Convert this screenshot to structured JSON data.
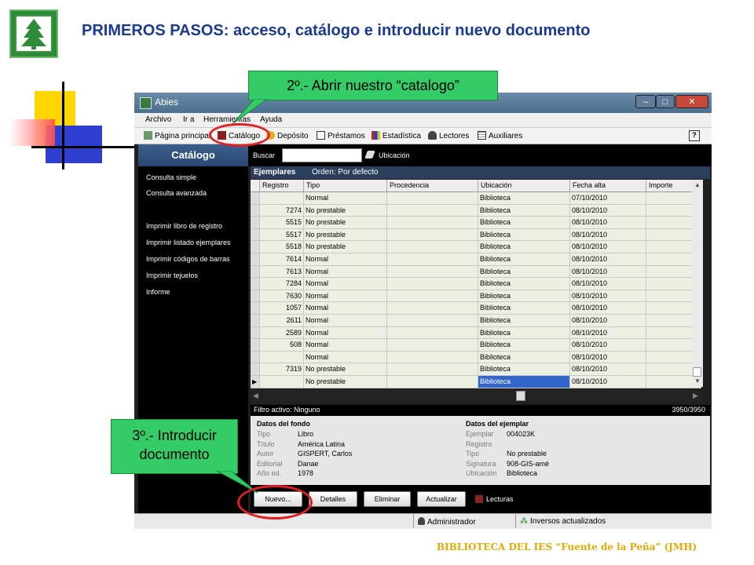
{
  "slide": {
    "title": "PRIMEROS PASOS: acceso, catálogo e introducir nuevo documento",
    "footer": "BIBLIOTECA DEL IES “Fuente de la Peña” (JMH)"
  },
  "callouts": {
    "step2": "2º.- Abrir nuestro “catalogo”",
    "step3_line1": "3º.- Introducir",
    "step3_line2": "documento"
  },
  "window": {
    "title": "Abies",
    "controls": {
      "minimize": "–",
      "maximize": "□",
      "close": "✕"
    },
    "menu": [
      "Archivo",
      "Ir a",
      "Herramientas",
      "Ayuda"
    ],
    "toolbar": [
      "Página principal",
      "Catálogo",
      "Depósito",
      "Préstamos",
      "Estadística",
      "Lectores",
      "Auxiliares"
    ],
    "help_button": "?"
  },
  "left_panel": {
    "title": "Catálogo",
    "items": [
      "Consulta simple",
      "Consulta avanzada",
      "Imprimir libro de registro",
      "Imprimir listado ejemplares",
      "Imprimir códigos de barras",
      "Imprimir tejuelos",
      "Informe"
    ]
  },
  "search": {
    "label": "Buscar",
    "value": "",
    "location_label": "Ubicación"
  },
  "ejemplares": {
    "title": "Ejemplares",
    "order": "Orden: Por defecto",
    "columns": [
      "Registro",
      "Tipo",
      "Procedencia",
      "Ubicación",
      "Fecha alta",
      "Importe"
    ],
    "rows": [
      [
        "",
        "Normal",
        "",
        "Biblioteca",
        "07/10/2010",
        ""
      ],
      [
        "7274",
        "No prestable",
        "",
        "Biblioteca",
        "08/10/2010",
        ""
      ],
      [
        "5515",
        "No prestable",
        "",
        "Biblioteca",
        "08/10/2010",
        ""
      ],
      [
        "5517",
        "No prestable",
        "",
        "Biblioteca",
        "08/10/2010",
        ""
      ],
      [
        "5518",
        "No prestable",
        "",
        "Biblioteca",
        "08/10/2010",
        ""
      ],
      [
        "7614",
        "Normal",
        "",
        "Biblioteca",
        "08/10/2010",
        ""
      ],
      [
        "7613",
        "Normal",
        "",
        "Biblioteca",
        "08/10/2010",
        ""
      ],
      [
        "7284",
        "Normal",
        "",
        "Biblioteca",
        "08/10/2010",
        ""
      ],
      [
        "7630",
        "Normal",
        "",
        "Biblioteca",
        "08/10/2010",
        ""
      ],
      [
        "1057",
        "Normal",
        "",
        "Biblioteca",
        "08/10/2010",
        ""
      ],
      [
        "2611",
        "Normal",
        "",
        "Biblioteca",
        "08/10/2010",
        ""
      ],
      [
        "2589",
        "Normal",
        "",
        "Biblioteca",
        "08/10/2010",
        ""
      ],
      [
        "508",
        "Normal",
        "",
        "Biblioteca",
        "08/10/2010",
        ""
      ],
      [
        "",
        "Normal",
        "",
        "Biblioteca",
        "08/10/2010",
        ""
      ],
      [
        "7319",
        "No prestable",
        "",
        "Biblioteca",
        "08/10/2010",
        ""
      ],
      [
        "",
        "No prestable",
        "",
        "Biblioteca",
        "08/10/2010",
        ""
      ]
    ],
    "filter": "Filtro activo: Ninguno",
    "count": "3950/3950"
  },
  "datos_fondo": {
    "title": "Datos del fondo",
    "fields": [
      {
        "label": "Tipo",
        "value": "Libro"
      },
      {
        "label": "Título",
        "value": "América Latina"
      },
      {
        "label": "Autor",
        "value": "GISPERT, Carlos"
      },
      {
        "label": "Editorial",
        "value": "Danae"
      },
      {
        "label": "Año ed.",
        "value": "1978"
      }
    ]
  },
  "datos_ejemplar": {
    "title": "Datos del ejemplar",
    "fields": [
      {
        "label": "Ejemplar",
        "value": "004023K"
      },
      {
        "label": "Registro",
        "value": ""
      },
      {
        "label": "Tipo",
        "value": "No prestable"
      },
      {
        "label": "Signatura",
        "value": "908-GIS-amé"
      },
      {
        "label": "Ubicación",
        "value": "Biblioteca"
      }
    ]
  },
  "buttons": {
    "nuevo": "Nuevo...",
    "detalles": "Detalles",
    "eliminar": "Eliminar",
    "actualizar": "Actualizar",
    "lecturas": "Lecturas"
  },
  "status": {
    "user": "Administrador",
    "inversos": "Inversos actualizados"
  },
  "colors": {
    "title_blue": "#1a3a8f",
    "callout_green": "#33cc66",
    "highlight_ring": "#e02020",
    "footer_gold": "#e6a800",
    "panel_header_blue": "#2a4770"
  }
}
